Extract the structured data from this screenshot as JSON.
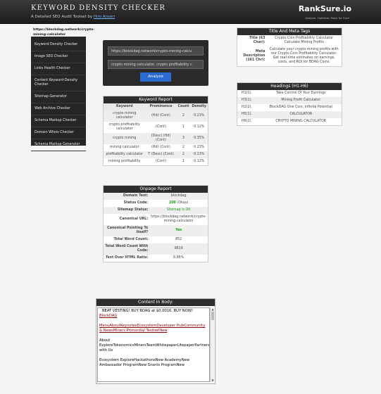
{
  "header": {
    "title": "KEYWORD DENSITY CHECKER",
    "subtitle_prefix": "A Detailed SEO Audit Toolset by ",
    "author": "Hiro Ansari",
    "brand": "RankSure.io",
    "brand_tagline": "Analyze. Optimize. Rank for Sure."
  },
  "url_label": "https://blockdag.network/crypto-mining-calculator",
  "sidebar": {
    "items": [
      {
        "label": "Keyword Density Checker"
      },
      {
        "label": "Image SEO Checker"
      },
      {
        "label": "Links Health Checker"
      },
      {
        "label": "Content Keyword-Density Checker"
      },
      {
        "label": "Sitemap Generator"
      },
      {
        "label": "Web Archive Checker"
      },
      {
        "label": "Schema Markup Checker"
      },
      {
        "label": "Domain Whois Checker"
      },
      {
        "label": "Schema Markup Generator"
      }
    ]
  },
  "inputs": {
    "url_value": "https://blockdag.network/crypto-mining-calcu",
    "keywords_value": "crypto mining calculator, crypto profitability c",
    "analyze_label": "Analyze"
  },
  "keyword_report": {
    "title": "Keyword Report",
    "headers": [
      "Keyword",
      "Prominence",
      "Count",
      "Density"
    ],
    "rows": [
      [
        "crypto mining calculator",
        "(Hd) (Cont)",
        "2",
        "0.23%"
      ],
      [
        "crypto profitability calculator",
        "(Cont)",
        "1",
        "0.12%"
      ],
      [
        "crypto mining",
        "(Desc) (Hd) (Cont)",
        "3",
        "0.35%"
      ],
      [
        "mining calculator",
        "(Hd) (Cont)",
        "2",
        "0.23%"
      ],
      [
        "profitability calculator",
        "T (Desc) (Cont)",
        "2",
        "0.23%"
      ],
      [
        "mining profitability",
        "(Cont)",
        "1",
        "0.12%"
      ]
    ]
  },
  "onpage_report": {
    "title": "Onpage Report",
    "rows": [
      {
        "label": "Domain Text:",
        "value": "blockdag",
        "style": ""
      },
      {
        "label": "Status Code:",
        "value": "200",
        "value_suffix": " (Okay)",
        "style": "code"
      },
      {
        "label": "Sitemap Status:",
        "value": "Sitemap is OK",
        "style": "greenplain"
      },
      {
        "label": "Canonical URL:",
        "value": "https://blockdag.network/crypto-mining-calculator",
        "style": ""
      },
      {
        "label": "Canonical Pointing To Itself?",
        "value": "Yes",
        "style": "green"
      },
      {
        "label": "Total Word Count:",
        "value": "852",
        "style": ""
      },
      {
        "label": "Total Word Count With Code:",
        "value": "9619",
        "style": ""
      },
      {
        "label": "Text Over HTML Ratio:",
        "value": "8.86%",
        "style": ""
      }
    ]
  },
  "title_meta": {
    "title": "Title And Meta Tags",
    "rows": [
      {
        "label": "Title (63 Char):",
        "value": "Crypto Coin Profitability Calculator Calculate Mining Profits"
      },
      {
        "label": "Meta Description (161 Chr):",
        "value": "Calculate your crypto mining profits with our Crypto Coin Profitability Calculator. Get real-time estimates on earnings, costs, and ROI for BDAG Coins."
      }
    ]
  },
  "headings": {
    "title": "Headings  (H1-H6)",
    "rows": [
      [
        "H1(1).",
        "Take Control Of Your Earnings"
      ],
      [
        "H3(1).",
        "Mining Profit Calculator"
      ],
      [
        "H2(2).",
        "BlockDAG  One Coin, Infinite Potential"
      ],
      [
        "H5(1).",
        "CALCULATOR"
      ],
      [
        "H6(2).",
        "CRYPTO MINING CALCULATOR"
      ]
    ]
  },
  "content_body": {
    "title": "Content In Body:",
    "line1a": "BEAT VESTING! BUY BDAG at $0.0016.  BUY NOW!",
    "line1b": "BlockDAG",
    "line2": "MenuAboutKeynotesEcosystemDeveloper HubCommunity & NewsMiners Primordial TestnetNew",
    "line3": "About ExploreTokenomicsMinersTeamWhitepaperLitepaperPartnersConnect with Us",
    "line4": "Ecosystem ExploreHackathonsNew AcademyNew Ambassador ProgramNew Grants ProgramNew"
  }
}
